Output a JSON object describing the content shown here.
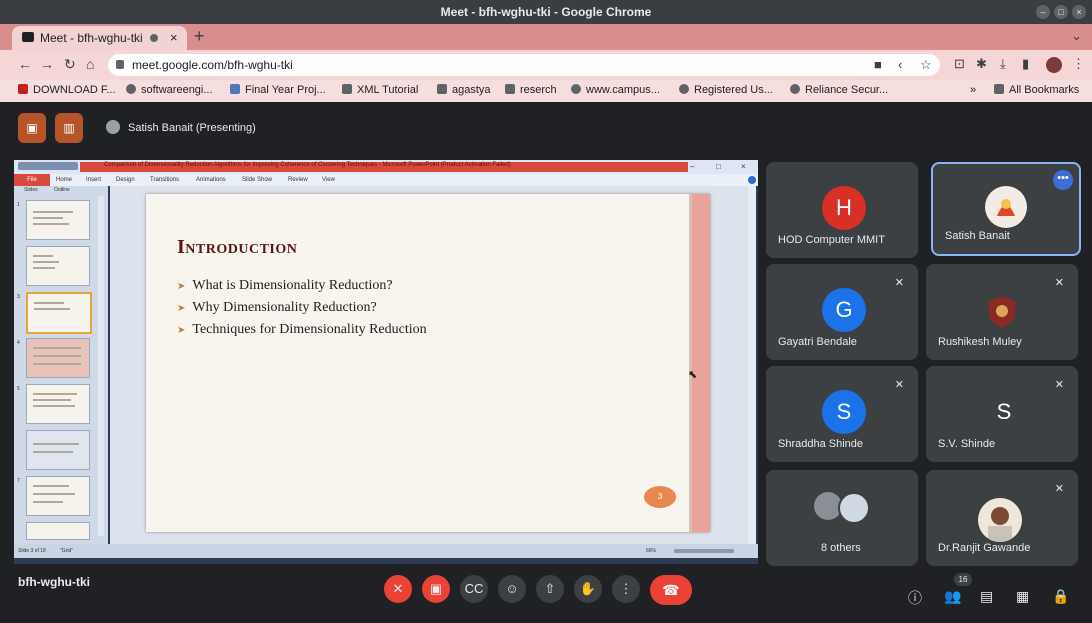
{
  "window": {
    "title": "Meet - bfh-wghu-tki - Google Chrome"
  },
  "tab": {
    "title": "Meet - bfh-wghu-tki"
  },
  "address": {
    "url": "meet.google.com/bfh-wghu-tki"
  },
  "bookmarks": [
    "DOWNLOAD F...",
    "softwareengi...",
    "Final Year Proj...",
    "XML Tutorial",
    "agastya",
    "reserch",
    "www.campus...",
    "Registered Us...",
    "Reliance Secur..."
  ],
  "all_bookmarks": "All Bookmarks",
  "presenter": {
    "label": "Satish Banait (Presenting)"
  },
  "ppt": {
    "title": "Comparison of Dimensionality Reduction Algorithms for Improving Coherence of Clustering Techniques - Microsoft PowerPoint (Product Activation Failed)",
    "file_tab": "File",
    "ribbon_tabs": [
      "Home",
      "Insert",
      "Design",
      "Transitions",
      "Animations",
      "Slide Show",
      "Review",
      "View"
    ],
    "pane_tabs": [
      "Slides",
      "Outline"
    ],
    "status_left": "Slide 3 of 18",
    "status_theme": "\"Grid\"",
    "zoom": "66%"
  },
  "slide": {
    "title": "Introduction",
    "bullets": [
      "What is Dimensionality Reduction?",
      "Why Dimensionality Reduction?",
      "Techniques for Dimensionality Reduction"
    ],
    "page": "3"
  },
  "participants": [
    {
      "name": "HOD Computer MMIT",
      "initial": "H",
      "color": "#d93025",
      "muted": false
    },
    {
      "name": "Satish Banait",
      "initial": "",
      "color": "#ffffff",
      "muted": false
    },
    {
      "name": "Gayatri Bendale",
      "initial": "G",
      "color": "#1a73e8",
      "muted": true
    },
    {
      "name": "Rushikesh Muley",
      "initial": "",
      "color": "#7b2d26",
      "muted": true
    },
    {
      "name": "Shraddha Shinde",
      "initial": "S",
      "color": "#1a73e8",
      "muted": true
    },
    {
      "name": "S.V. Shinde",
      "initial": "S",
      "color": "#3c4043",
      "muted": true
    },
    {
      "name": "8 others",
      "initial": "",
      "color": "#3c4043",
      "muted": false
    },
    {
      "name": "Dr.Ranjit Gawande",
      "initial": "",
      "color": "#f0e6da",
      "muted": true
    }
  ],
  "meeting": {
    "code": "bfh-wghu-tki",
    "participant_count": "16"
  },
  "icons": {
    "mic_off": "mic-off-icon",
    "cam_off": "videocam-off-icon",
    "cc": "closed-caption-icon",
    "emoji": "emoji-icon",
    "present": "present-screen-icon",
    "hand": "raise-hand-icon",
    "more": "more-vert-icon",
    "leave": "call-end-icon"
  }
}
